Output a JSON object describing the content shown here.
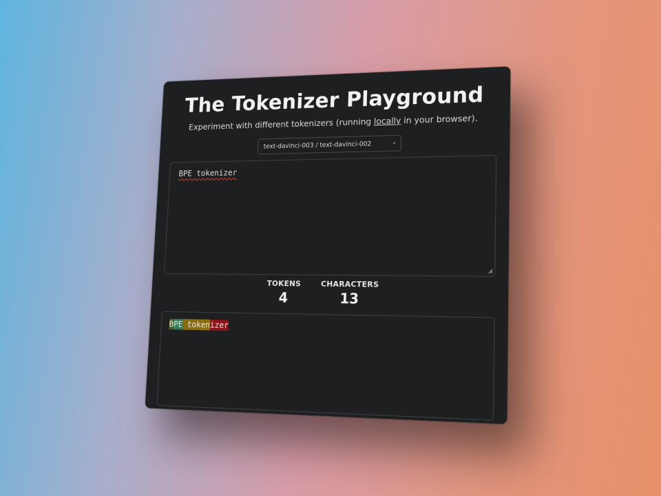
{
  "header": {
    "title": "The Tokenizer Playground",
    "subtitle_pre": "Experiment with different tokenizers (running ",
    "subtitle_link": "locally",
    "subtitle_post": " in your browser)."
  },
  "model_select": {
    "value": "text-davinci-003 / text-davinci-002"
  },
  "input": {
    "text": "BPE tokenizer"
  },
  "stats": {
    "tokens_label": "TOKENS",
    "tokens_value": "4",
    "characters_label": "CHARACTERS",
    "characters_value": "13"
  },
  "tokens": [
    {
      "text": "B",
      "color": "#4b5a1e"
    },
    {
      "text": "PE",
      "color": "#2d7a55"
    },
    {
      "text": " token",
      "color": "#8a6d12"
    },
    {
      "text": "izer",
      "color": "#8c1418"
    }
  ]
}
